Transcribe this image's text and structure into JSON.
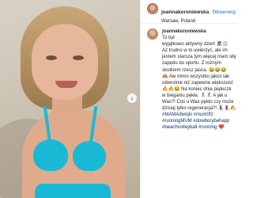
{
  "post": {
    "username": "joannakoroniewska",
    "follow_label": "Obserwuj",
    "location": "Warsaw, Poland",
    "carousel_next_icon": "chevron-right-icon",
    "caption_user": "joannakoroniewska",
    "caption_lines": [
      "To był",
      "wyjątkowo aktywny dzień 🏖🏐",
      "Aż trudno w to uwierzyć, ale im",
      "jestem starsza tym więcej mam siły",
      "zapędu do sportu. Z rożnym",
      "skutkiem rzecz jasna. 😂😂😂",
      "🙈 Ale mimo wszystko jakoś tak",
      "odwrotnie niż zapewne większość",
      "🔥🔥😂 Na koniec dnia piąteczk",
      "w bieganiu pękła. 🏃‍♀️🏃‍♀️ A jak u",
      "Was?! Coś u Was pękło czy może",
      "dzisiaj tylko regeneracja?! 🧘‍♀️🧘‍♀️🔥",
      "#MAMAdwójki #mum0f2",
      "#runningMUM #dowborybehapp",
      "#beachvolleyball #running ❤️"
    ]
  }
}
